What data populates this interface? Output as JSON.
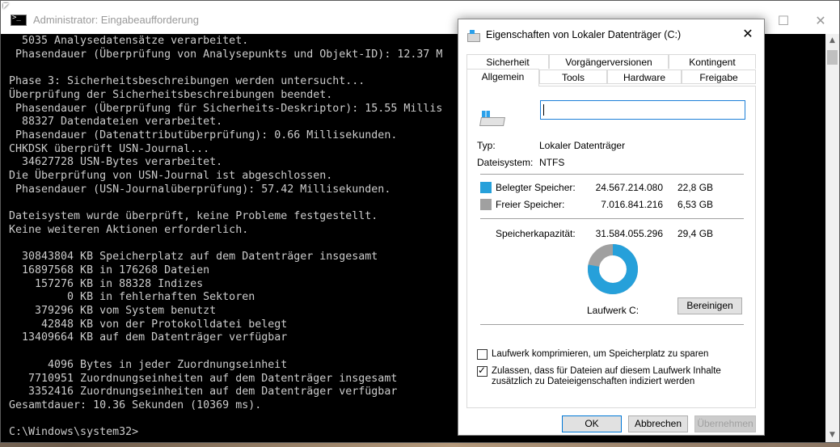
{
  "console": {
    "title": "Administrator: Eingabeaufforderung",
    "buttons": {
      "minimize": "—",
      "maximize": "☐",
      "close": "✕"
    },
    "lines": [
      "  5035 Analysedatensätze verarbeitet.",
      " Phasendauer (Überprüfung von Analysepunkts und Objekt-ID): 12.37 M",
      "",
      "Phase 3: Sicherheitsbeschreibungen werden untersucht...",
      "Überprüfung der Sicherheitsbeschreibungen beendet.",
      " Phasendauer (Überprüfung für Sicherheits-Deskriptor): 15.55 Millis",
      "  88327 Datendateien verarbeitet.",
      " Phasendauer (Datenattributüberprüfung): 0.66 Millisekunden.",
      "CHKDSK überprüft USN-Journal...",
      "  34627728 USN-Bytes verarbeitet.",
      "Die Überprüfung von USN-Journal ist abgeschlossen.",
      " Phasendauer (USN-Journalüberprüfung): 57.42 Millisekunden.",
      "",
      "Dateisystem wurde überprüft, keine Probleme festgestellt.",
      "Keine weiteren Aktionen erforderlich.",
      "",
      "  30843804 KB Speicherplatz auf dem Datenträger insgesamt",
      "  16897568 KB in 176268 Dateien",
      "    157276 KB in 88328 Indizes",
      "         0 KB in fehlerhaften Sektoren",
      "    379296 KB vom System benutzt",
      "     42848 KB von der Protokolldatei belegt",
      "  13409664 KB auf dem Datenträger verfügbar",
      "",
      "      4096 Bytes in jeder Zuordnungseinheit",
      "   7710951 Zuordnungseinheiten auf dem Datenträger insgesamt",
      "   3352416 Zuordnungseinheiten auf dem Datenträger verfügbar",
      "Gesamtdauer: 10.36 Sekunden (10369 ms).",
      "",
      "C:\\Windows\\system32>"
    ]
  },
  "dialog": {
    "title": "Eigenschaften von Lokaler Datenträger (C:)",
    "close": "✕",
    "tabs_row1": [
      "Sicherheit",
      "Vorgängerversionen",
      "Kontingent"
    ],
    "tabs_row2": [
      "Allgemein",
      "Tools",
      "Hardware",
      "Freigabe"
    ],
    "active_tab": "Allgemein",
    "name_value": "",
    "type_label": "Typ:",
    "type_value": "Lokaler Datenträger",
    "fs_label": "Dateisystem:",
    "fs_value": "NTFS",
    "used_label": "Belegter Speicher:",
    "used_bytes": "24.567.214.080",
    "used_gb": "22,8 GB",
    "free_label": "Freier Speicher:",
    "free_bytes": "7.016.841.216",
    "free_gb": "6,53 GB",
    "capacity_label": "Speicherkapazität:",
    "capacity_bytes": "31.584.055.296",
    "capacity_gb": "29,4 GB",
    "drive_label": "Laufwerk C:",
    "cleanup_button": "Bereinigen",
    "compress_label": "Laufwerk komprimieren, um Speicherplatz zu sparen",
    "compress_checked": false,
    "index_label": "Zulassen, dass für Dateien auf diesem Laufwerk Inhalte zusätzlich zu Dateieigenschaften indiziert werden",
    "index_checked": true,
    "ok_button": "OK",
    "cancel_button": "Abbrechen",
    "apply_button": "Übernehmen",
    "colors": {
      "used": "#26a0da",
      "free": "#a0a0a0"
    },
    "used_fraction": 0.778
  }
}
